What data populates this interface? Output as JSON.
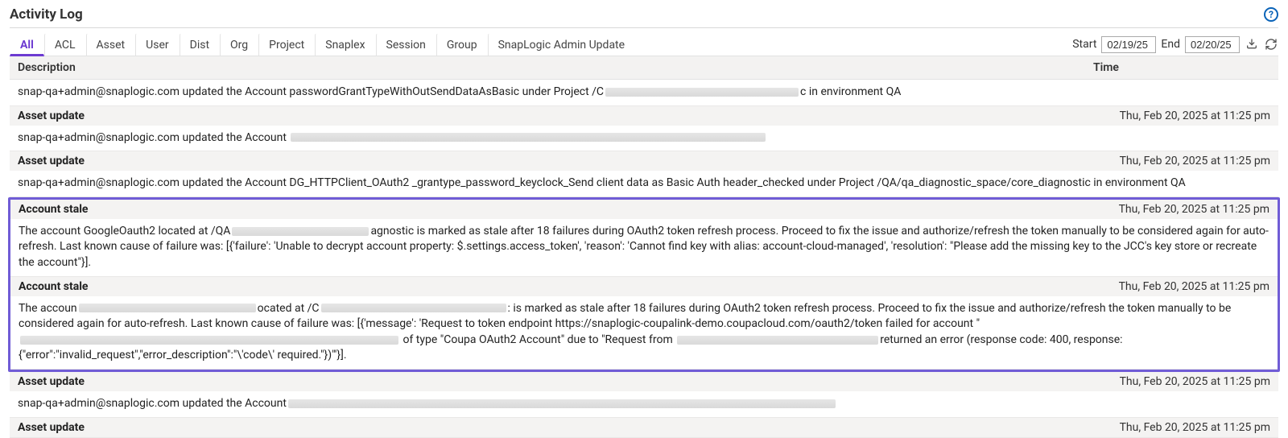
{
  "header": {
    "title": "Activity Log"
  },
  "tabs": [
    "All",
    "ACL",
    "Asset",
    "User",
    "Dist",
    "Org",
    "Project",
    "Snaplex",
    "Session",
    "Group",
    "SnapLogic Admin Update"
  ],
  "active_tab": 0,
  "filters": {
    "start_label": "Start",
    "start_value": "02/19/25",
    "end_label": "End",
    "end_value": "02/20/25"
  },
  "columns": {
    "description": "Description",
    "time": "Time"
  },
  "entries": [
    {
      "title": null,
      "time": null,
      "desc_parts": [
        "snap-qa+admin@snaplogic.com updated the Account passwordGrantTypeWithOutSendDataAsBasic under Project /C",
        "c in environment QA"
      ],
      "redact_widths": [
        240
      ]
    },
    {
      "title": "Asset update",
      "time": "Thu, Feb 20, 2025 at 11:25 pm",
      "desc_parts": [
        "snap-qa+admin@snaplogic.com updated the Account "
      ],
      "redact_widths": [
        590
      ]
    },
    {
      "title": "Asset update",
      "time": "Thu, Feb 20, 2025 at 11:25 pm",
      "desc_parts": [
        "snap-qa+admin@snaplogic.com updated the Account DG_HTTPClient_OAuth2 _grantype_password_keyclock_Send client data as Basic Auth header_checked under Project /QA/qa_diagnostic_space/core_diagnostic in environment QA"
      ],
      "redact_widths": []
    },
    {
      "title": "Account stale",
      "time": "Thu, Feb 20, 2025 at 11:25 pm",
      "desc_parts": [
        "The account GoogleOauth2 located at /QA",
        "agnostic is marked as stale after 18 failures during OAuth2 token refresh process. Proceed to fix the issue and authorize/refresh the token manually to be considered again for auto-refresh. Last known cause of failure was: [{'failure': 'Unable to decrypt account property: $.settings.access_token', 'reason': 'Cannot find key with alias: account-cloud-managed', 'resolution': \"Please add the missing key to the JCC's key store or recreate the account\"}]."
      ],
      "redact_widths": [
        170
      ]
    },
    {
      "title": "Account stale",
      "time": "Thu, Feb 20, 2025 at 11:25 pm",
      "desc_parts": [
        "The accoun",
        "ocated at /C",
        ": is marked as stale after 18 failures during OAuth2 token refresh process. Proceed to fix the issue and authorize/refresh the token manually to be considered again for auto-refresh. Last known cause of failure was: [{'message': 'Request to token endpoint https://snaplogic-coupalink-demo.coupacloud.com/oauth2/token failed for account \"",
        " of type \"Coupa OAuth2 Account\" due to \"Request from ",
        "returned an error (response code: 400, response: {\"error\":\"invalid_request\",\"error_description\":\"\\'code\\' required.\"})\"'}]."
      ],
      "redact_widths": [
        220,
        230,
        470,
        250
      ]
    },
    {
      "title": "Asset update",
      "time": "Thu, Feb 20, 2025 at 11:25 pm",
      "desc_parts": [
        "snap-qa+admin@snaplogic.com updated the Account"
      ],
      "redact_widths": [
        680
      ]
    },
    {
      "title": "Asset update",
      "time": "Thu, Feb 20, 2025 at 11:25 pm",
      "desc_parts": [],
      "redact_widths": []
    }
  ],
  "highlighted_entries": [
    3,
    4
  ]
}
